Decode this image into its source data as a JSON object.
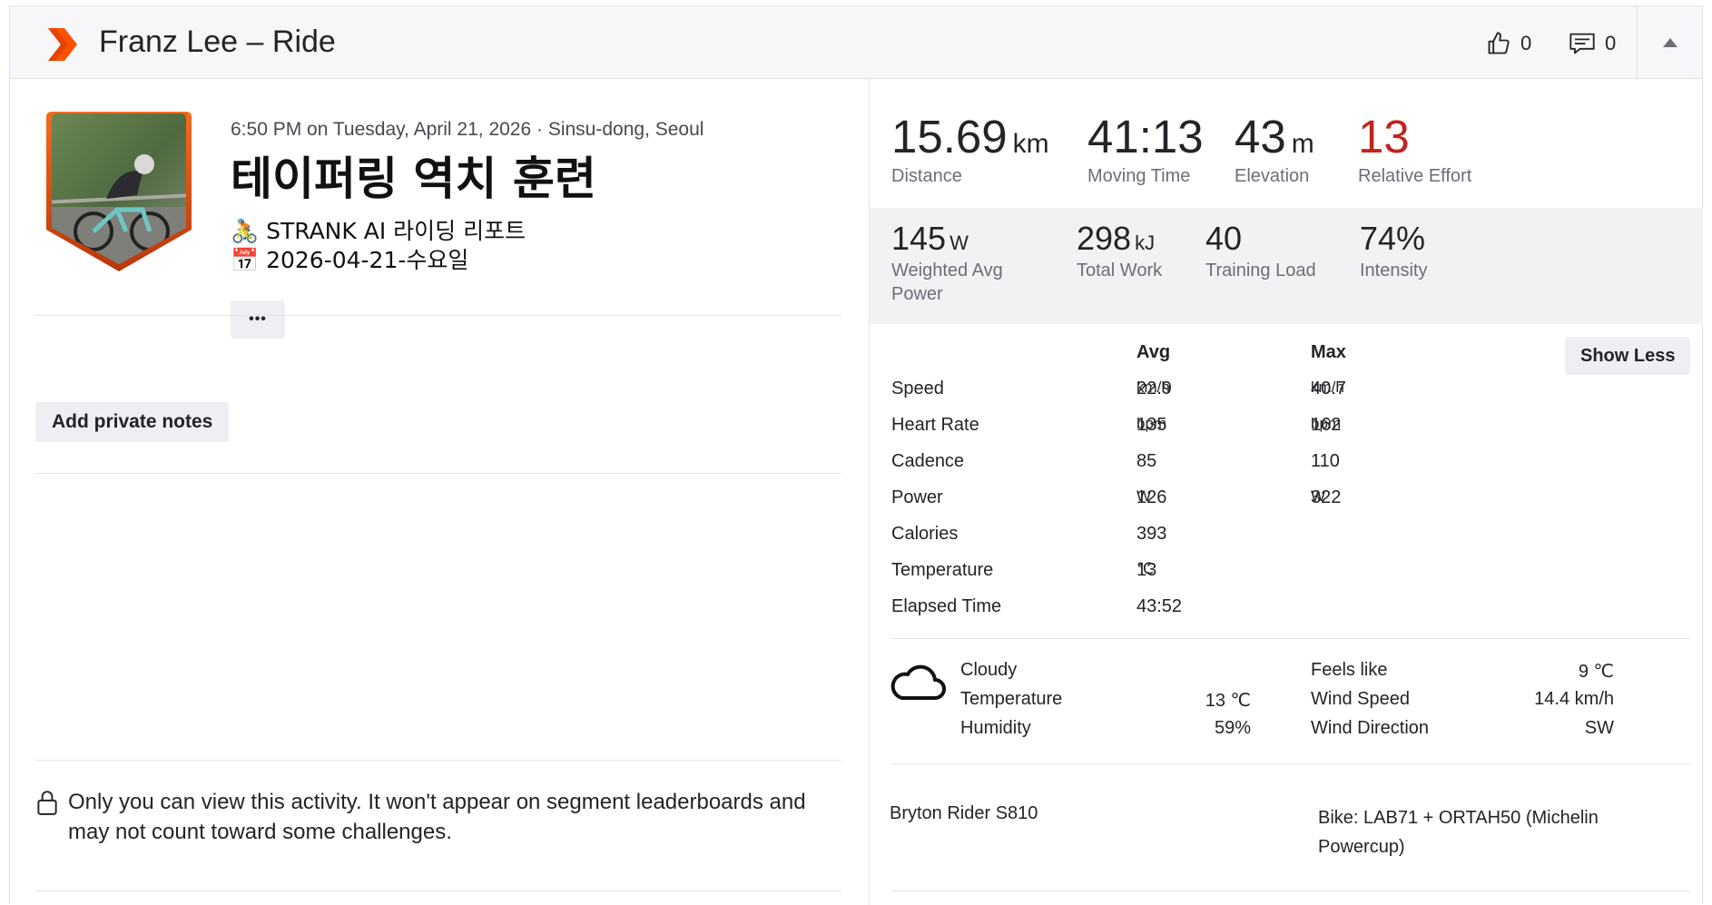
{
  "header": {
    "title": "Franz Lee – Ride",
    "kudos_count": "0",
    "comment_count": "0",
    "brand_color": "#fc5200"
  },
  "activity": {
    "meta": "6:50 PM on Tuesday, April 21, 2026 · Sinsu-dong, Seoul",
    "title": "테이퍼링 역치 훈련",
    "description_line1": "🚴 STRANK AI 라이딩 리포트",
    "description_line2": "📅 2026-04-21-수요일",
    "more_label": "•••",
    "private_notes_label": "Add private notes",
    "privacy_note": "Only you can view this activity. It won't appear on segment leaderboards and may not count toward some challenges."
  },
  "primary_stats": [
    {
      "value": "15.69",
      "unit": "km",
      "label": "Distance"
    },
    {
      "value": "41:13",
      "unit": "",
      "label": "Moving Time"
    },
    {
      "value": "43",
      "unit": "m",
      "label": "Elevation"
    },
    {
      "value": "13",
      "unit": "",
      "label": "Relative Effort"
    }
  ],
  "secondary_stats": [
    {
      "value": "145",
      "unit": "W",
      "label_1": "Weighted Avg",
      "label_2": "Power"
    },
    {
      "value": "298",
      "unit": "kJ",
      "label_1": "Total Work",
      "label_2": ""
    },
    {
      "value": "40",
      "unit": "",
      "label_1": "Training Load",
      "label_2": ""
    },
    {
      "value": "74%",
      "unit": "",
      "label_1": "Intensity",
      "label_2": ""
    }
  ],
  "metrics_table": {
    "avg_header": "Avg",
    "max_header": "Max",
    "show_less_label": "Show Less",
    "rows": [
      {
        "name": "Speed",
        "avg": "22.9",
        "avg_unit": "km/h",
        "max": "40.7",
        "max_unit": "km/h"
      },
      {
        "name": "Heart Rate",
        "avg": "135",
        "avg_unit": "bpm",
        "max": "162",
        "max_unit": "bpm"
      },
      {
        "name": "Cadence",
        "avg": "85",
        "avg_unit": "",
        "max": "110",
        "max_unit": ""
      },
      {
        "name": "Power",
        "avg": "126",
        "avg_unit": "W",
        "max": "322",
        "max_unit": "W"
      },
      {
        "name": "Calories",
        "avg": "393",
        "avg_unit": "",
        "max": "",
        "max_unit": ""
      },
      {
        "name": "Temperature",
        "avg": "13",
        "avg_unit": "℃",
        "max": "",
        "max_unit": ""
      },
      {
        "name": "Elapsed Time",
        "avg": "43:52",
        "avg_unit": "",
        "max": "",
        "max_unit": ""
      }
    ]
  },
  "weather": {
    "icon": "cloud-icon",
    "condition": "Cloudy",
    "temperature_label": "Temperature",
    "temperature_value": "13 ℃",
    "humidity_label": "Humidity",
    "humidity_value": "59%",
    "feels_like_label": "Feels like",
    "feels_like_value": "9 ℃",
    "wind_speed_label": "Wind Speed",
    "wind_speed_value": "14.4 km/h",
    "wind_direction_label": "Wind Direction",
    "wind_direction_value": "SW"
  },
  "equipment": {
    "device": "Bryton Rider S810",
    "bike": "Bike: LAB71 + ORTAH50 (Michelin Powercup)"
  }
}
